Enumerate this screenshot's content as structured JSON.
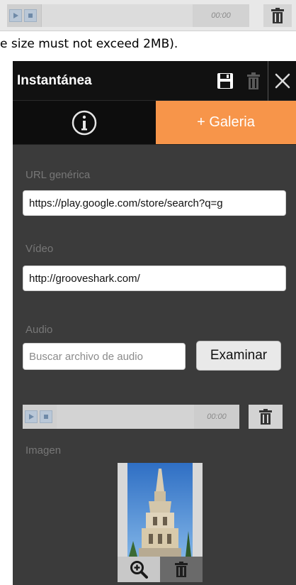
{
  "top_player": {
    "time": "00:00"
  },
  "notice": "e size must not exceed 2MB).",
  "panel": {
    "title": "Instantánea",
    "tabs": {
      "gallery_label": "+ Galeria"
    },
    "generic_url": {
      "label": "URL genérica",
      "value": "https://play.google.com/store/search?q=g"
    },
    "video": {
      "label": "Vídeo",
      "value": "http://grooveshark.com/"
    },
    "audio": {
      "label": "Audio",
      "placeholder": "Buscar archivo de audio",
      "browse_label": "Examinar"
    },
    "audio_player": {
      "time": "00:00"
    },
    "image": {
      "label": "Imagen"
    }
  },
  "icons": {
    "save": "floppy-disk-icon",
    "delete": "trash-icon",
    "close": "close-icon",
    "info": "info-icon",
    "zoom": "zoom-in-icon",
    "play": "play-icon",
    "stop": "stop-icon"
  },
  "colors": {
    "accent": "#f7954a",
    "panel_bg": "#3b3b3b",
    "header_bg": "#111111"
  }
}
